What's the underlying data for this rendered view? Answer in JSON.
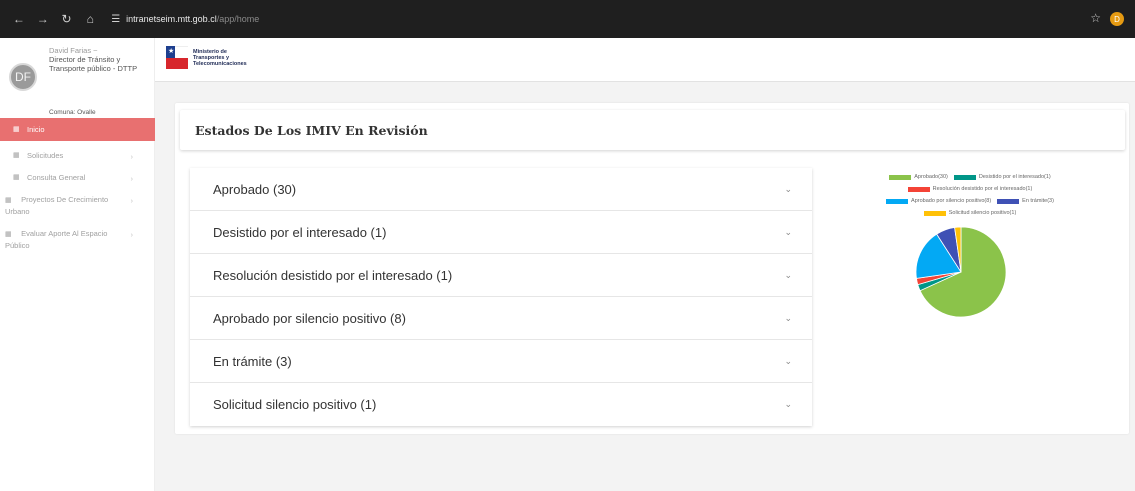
{
  "browser": {
    "url_host": "intranetseim.mtt.gob.cl",
    "url_path": "/app/home",
    "profile_initial": "D"
  },
  "sidebar": {
    "avatar_initials": "DF",
    "user_name": "David Farias ~",
    "user_role": "Director de Tránsito y Transporte público - DTTP",
    "user_commune": "Comuna: Ovalle",
    "items": [
      {
        "label": "Inicio",
        "active": true
      },
      {
        "label": "Solicitudes",
        "active": false
      },
      {
        "label": "Consulta General",
        "active": false
      },
      {
        "label": "Proyectos De Crecimiento Urbano",
        "active": false
      },
      {
        "label": "Evaluar Aporte Al Espacio Público",
        "active": false
      }
    ]
  },
  "header": {
    "ministry_line1": "Ministerio de",
    "ministry_line2": "Transportes y",
    "ministry_line3": "Telecomunicaciones"
  },
  "main": {
    "title": "Estados De Los IMIV En Revisión",
    "states": [
      {
        "label": "Aprobado (30)"
      },
      {
        "label": "Desistido por el interesado (1)"
      },
      {
        "label": "Resolución desistido por el interesado (1)"
      },
      {
        "label": "Aprobado por silencio positivo (8)"
      },
      {
        "label": "En trámite (3)"
      },
      {
        "label": "Solicitud silencio positivo (1)"
      }
    ]
  },
  "chart_data": {
    "type": "pie",
    "categories": [
      "Aprobado(30)",
      "Desistido por el interesado(1)",
      "Resolución desistido por el interesado(1)",
      "Aprobado por silencio positivo(8)",
      "En trámite(3)",
      "Solicitud silencio positivo(1)"
    ],
    "values": [
      30,
      1,
      1,
      8,
      3,
      1
    ],
    "colors": [
      "#8bc34a",
      "#009688",
      "#f44336",
      "#03a9f4",
      "#3f51b5",
      "#ffc107"
    ],
    "legend": "top"
  }
}
